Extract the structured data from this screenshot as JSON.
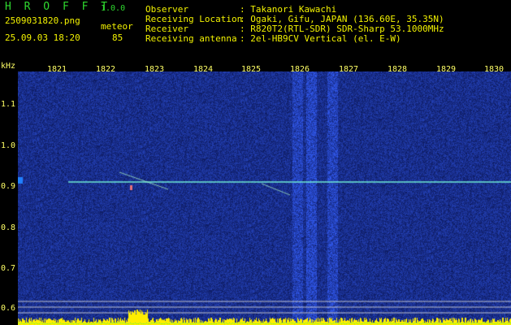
{
  "app": {
    "name": "H R O F F T",
    "version": "1.0.0"
  },
  "file": {
    "name": "2509031820.png",
    "datetime": "25.09.03 18:20"
  },
  "meteor": {
    "label": "meteor",
    "count": "85"
  },
  "info": [
    {
      "key": "Observer",
      "value": ": Takanori Kawachi"
    },
    {
      "key": "Receiving Location",
      "value": ": Ogaki, Gifu, JAPAN (136.60E, 35.35N)"
    },
    {
      "key": "Receiver",
      "value": ": R820T2(RTL-SDR) SDR-Sharp 53.1000MHz"
    },
    {
      "key": "Receiving antenna",
      "value": ": 2el-HB9CV Vertical (el. E-W)"
    }
  ],
  "axis": {
    "x_ticks": [
      "1821",
      "1822",
      "1823",
      "1824",
      "1825",
      "1826",
      "1827",
      "1828",
      "1829",
      "1830"
    ],
    "y_unit": "kHz",
    "y_ticks": [
      "1.1",
      "1.0",
      "0.9",
      "0.8",
      "0.7",
      "0.6"
    ]
  },
  "colors": {
    "header_green": "#2fd92f",
    "header_yellow": "#f2f200",
    "axis_yellow": "#ffff66"
  }
}
